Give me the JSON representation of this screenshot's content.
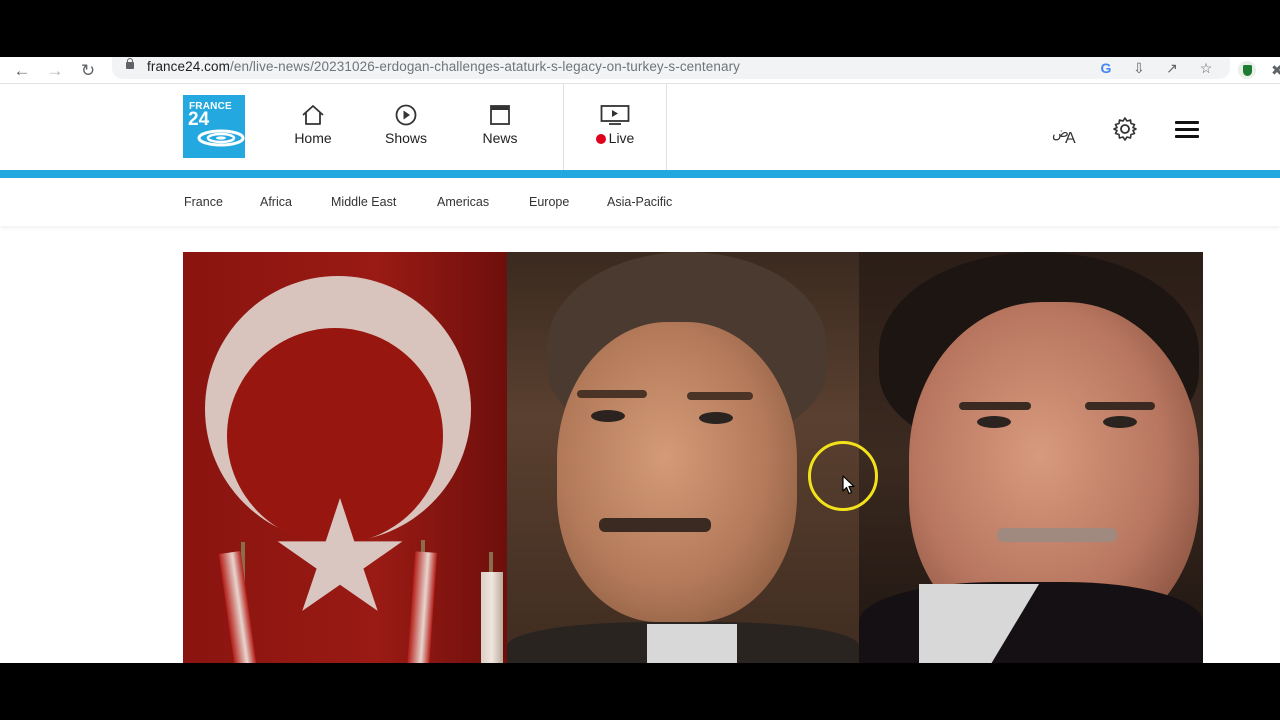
{
  "browser": {
    "url_host": "france24.com",
    "url_path": "/en/live-news/20231026-erdogan-challenges-ataturk-s-legacy-on-turkey-s-centenary"
  },
  "header": {
    "logo_line1": "FRANCE",
    "logo_line2": "24",
    "nav": [
      {
        "label": "Home",
        "icon": "home-icon"
      },
      {
        "label": "Shows",
        "icon": "play-circle-icon"
      },
      {
        "label": "News",
        "icon": "newspaper-icon"
      },
      {
        "label": "Live",
        "icon": "tv-icon"
      }
    ],
    "right_icons": [
      "language-icon",
      "settings-gear-icon",
      "hamburger-menu-icon"
    ],
    "lang_icon_text_ar": "ض",
    "lang_icon_text_en": "A"
  },
  "subnav": {
    "items": [
      "France",
      "Africa",
      "Middle East",
      "Americas",
      "Europe",
      "Asia-Pacific"
    ]
  },
  "colors": {
    "brand_blue": "#23a8e0",
    "live_red": "#e0001b",
    "cursor_highlight": "#f2e21b"
  }
}
